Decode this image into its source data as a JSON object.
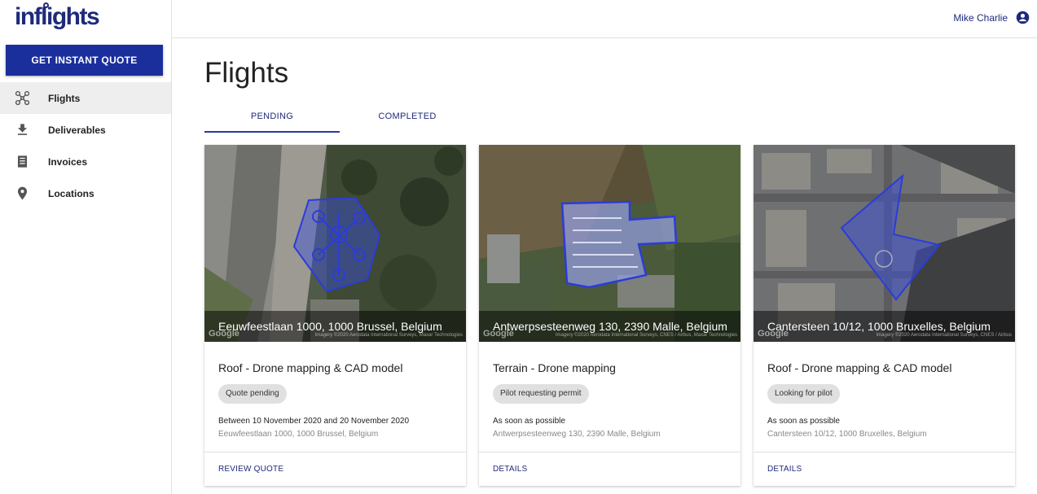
{
  "app": {
    "logo_text": "inflights",
    "brand_color": "#1a2f9c"
  },
  "sidebar": {
    "quote_button": "GET INSTANT QUOTE",
    "items": [
      {
        "label": "Flights",
        "icon": "drone-icon",
        "active": true
      },
      {
        "label": "Deliverables",
        "icon": "download-icon",
        "active": false
      },
      {
        "label": "Invoices",
        "icon": "invoice-icon",
        "active": false
      },
      {
        "label": "Locations",
        "icon": "location-pin-icon",
        "active": false
      }
    ]
  },
  "header": {
    "user_name": "Mike Charlie",
    "user_icon": "account-circle-icon"
  },
  "main": {
    "title": "Flights",
    "tabs": [
      {
        "label": "PENDING",
        "active": true
      },
      {
        "label": "COMPLETED",
        "active": false
      }
    ],
    "cards": [
      {
        "map_address": "Eeuwfeestlaan 1000, 1000 Brussel, Belgium",
        "map_google": "Google",
        "map_credit": "Imagery ©2020 Aerodata International Surveys, Maxar Technologies",
        "title": "Roof - Drone mapping & CAD model",
        "status": "Quote pending",
        "date": "Between 10 November 2020 and 20 November 2020",
        "location": "Eeuwfeestlaan 1000, 1000 Brussel, Belgium",
        "action": "REVIEW QUOTE"
      },
      {
        "map_address": "Antwerpsesteenweg 130, 2390 Malle, Belgium",
        "map_google": "Google",
        "map_credit": "Imagery ©2020 Aerodata International Surveys, CNES / Airbus, Maxar Technologies",
        "title": "Terrain - Drone mapping",
        "status": "Pilot requesting permit",
        "date": "As soon as possible",
        "location": "Antwerpsesteenweg 130, 2390 Malle, Belgium",
        "action": "DETAILS"
      },
      {
        "map_address": "Cantersteen 10/12, 1000 Bruxelles, Belgium",
        "map_google": "Google",
        "map_credit": "Imagery ©2020 Aerodata International Surveys, CNES / Airbus",
        "title": "Roof - Drone mapping & CAD model",
        "status": "Looking for pilot",
        "date": "As soon as possible",
        "location": "Cantersteen 10/12, 1000 Bruxelles, Belgium",
        "action": "DETAILS"
      }
    ]
  }
}
